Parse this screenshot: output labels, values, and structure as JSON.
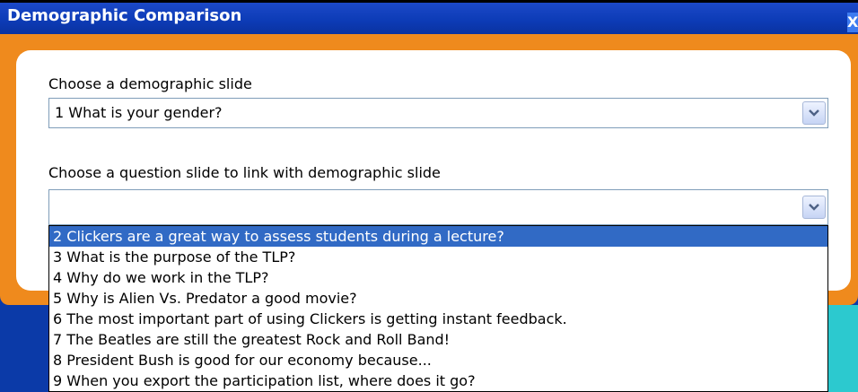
{
  "window": {
    "title": "Demographic Comparison",
    "close_glyph": "X"
  },
  "form": {
    "demographic_label": "Choose a demographic slide",
    "demographic_value": "1  What is your gender?",
    "question_label": "Choose a question slide to link with demographic slide",
    "question_value": ""
  },
  "dropdown": {
    "items": [
      "2  Clickers are a great way to assess students during a lecture?",
      "3  What is the purpose of the TLP?",
      "4  Why do we work in the TLP?",
      "5  Why is Alien Vs. Predator a good movie?",
      "6  The most important part of using Clickers is getting instant feedback.",
      "7  The Beatles are still the greatest Rock and Roll Band!",
      "8  President Bush is good for our economy because...",
      "9  When you export the participation list, where does it go?"
    ],
    "selected_index": 0
  },
  "colors": {
    "titlebar": "#0d3cb7",
    "panel_border": "#ef8a1d",
    "selection": "#316ac5"
  }
}
